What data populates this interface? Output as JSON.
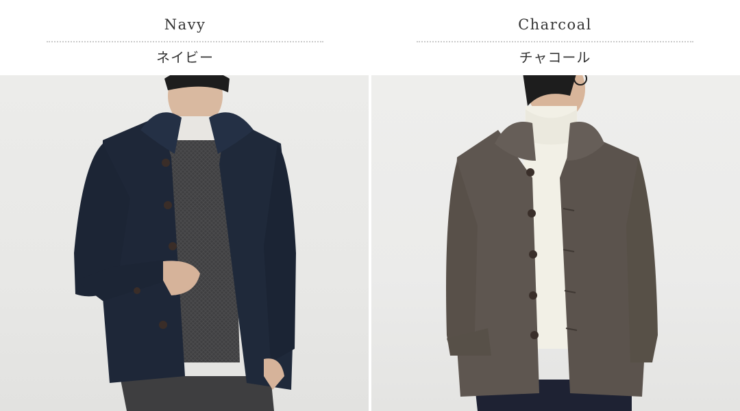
{
  "colors": [
    {
      "id": "navy",
      "name_en": "Navy",
      "name_ja": "ネイビー",
      "swatch": "#1e2738"
    },
    {
      "id": "charcoal",
      "name_en": "Charcoal",
      "name_ja": "チャコール",
      "swatch": "#5e5650"
    }
  ],
  "theme": {
    "text": "#333333",
    "divider": "#c9c9c9",
    "background": "#ffffff"
  }
}
